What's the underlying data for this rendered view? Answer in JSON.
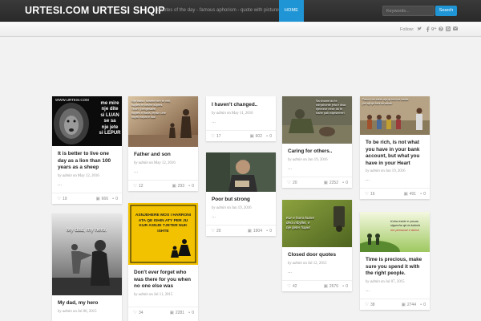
{
  "header": {
    "logo": "URTESI.COM URTESI SHQIP",
    "tagline": "Quotes of the day - famous aphorism - quote with pictures",
    "nav_home": "HOME",
    "search_placeholder": "Keywords...",
    "search_button": "Search",
    "brand_color": "#1f95d6"
  },
  "subbar": {
    "follow_label": "Follow:",
    "social_icons": [
      "twitter-icon",
      "facebook-icon",
      "google-plus-icon",
      "pinterest-icon",
      "rss-icon",
      "email-icon"
    ]
  },
  "cards": [
    {
      "title": "It is better to live one day as a lion than 100 years as a sheep",
      "date": "on May 12, 2016",
      "more": "...",
      "likes": "19",
      "views": "666",
      "comments": "0",
      "image_text": [
        "me mire",
        "nje dite",
        "si LUAN",
        "se sa",
        "nje jete",
        "si LEPUR"
      ],
      "image_watermark": "WWW.URTESI.COM"
    },
    {
      "title": "My dad, my hero",
      "date": "on Jul 06, 2015",
      "more": "",
      "likes": "",
      "views": "",
      "comments": "",
      "image_text": [
        "My dad, my hero."
      ]
    },
    {
      "title": "Father and son",
      "date": "on May 12, 2016",
      "more": "...",
      "likes": "12",
      "views": "293",
      "comments": "0",
      "image_text": [
        "Nje baba i shkete bire te veti,",
        "kujdes te keshe kujdes",
        "I bori i pengesave",
        "kujdes ti baba, lepsin une",
        "ndjek hapat e tua!"
      ]
    },
    {
      "title": "Don't ever forget who was there for you when no one else was",
      "date": "on Jul 11, 2015",
      "more": "",
      "likes": "34",
      "views": "2281",
      "comments": "0",
      "image_text": [
        "ASNJEHERE MOS I HARRONI",
        "ATA QE ISHIN ATY PER JU",
        "KUR ASNJE TJETER NUK ISHTE"
      ]
    },
    {
      "title": "I haven't changed..",
      "date": "on May 11, 2016",
      "more": "...",
      "likes": "17",
      "views": "602",
      "comments": "0"
    },
    {
      "title": "Poor but strong",
      "date": "on Jun 19, 2016",
      "more": "...",
      "likes": "20",
      "views": "1904",
      "comments": "0"
    },
    {
      "title": "Caring for others..",
      "date": "on Jun 19, 2016",
      "more": "...",
      "likes": "20",
      "views": "2252",
      "comments": "0",
      "image_text": [
        "Sa shume do te",
        "ndryshonte jeta e disa",
        "njerezve nese do te",
        "kishe pak ndjeshmeri"
      ]
    },
    {
      "title": "Closed door quotes",
      "date": "on Jul 12, 2015",
      "more": "...",
      "likes": "42",
      "views": "2676",
      "comments": "0",
      "image_text": [
        "Kur e hurra kuore",
        "dera mbyllet, e",
        "nje tjeter hapet"
      ]
    },
    {
      "title": "To be rich, is not what you have in your bank account, but what you have in your Heart",
      "date": "on Jun 19, 2016",
      "more": "...",
      "likes": "16",
      "views": "491",
      "comments": "0",
      "image_text": [
        "Pasuri nuk eshte ajo qe keni ne banke",
        "por ajo qe keni ne zemer"
      ]
    },
    {
      "title": "Time is precious, make sure you spend it with the right people.",
      "date": "on Jul 07, 2015",
      "more": "...",
      "likes": "38",
      "views": "2744",
      "comments": "0",
      "image_text": [
        "Koha eshte e çmuar,",
        "sigurohu qe ta kalosh",
        "me personat e duhur"
      ]
    }
  ],
  "author": "by admin"
}
